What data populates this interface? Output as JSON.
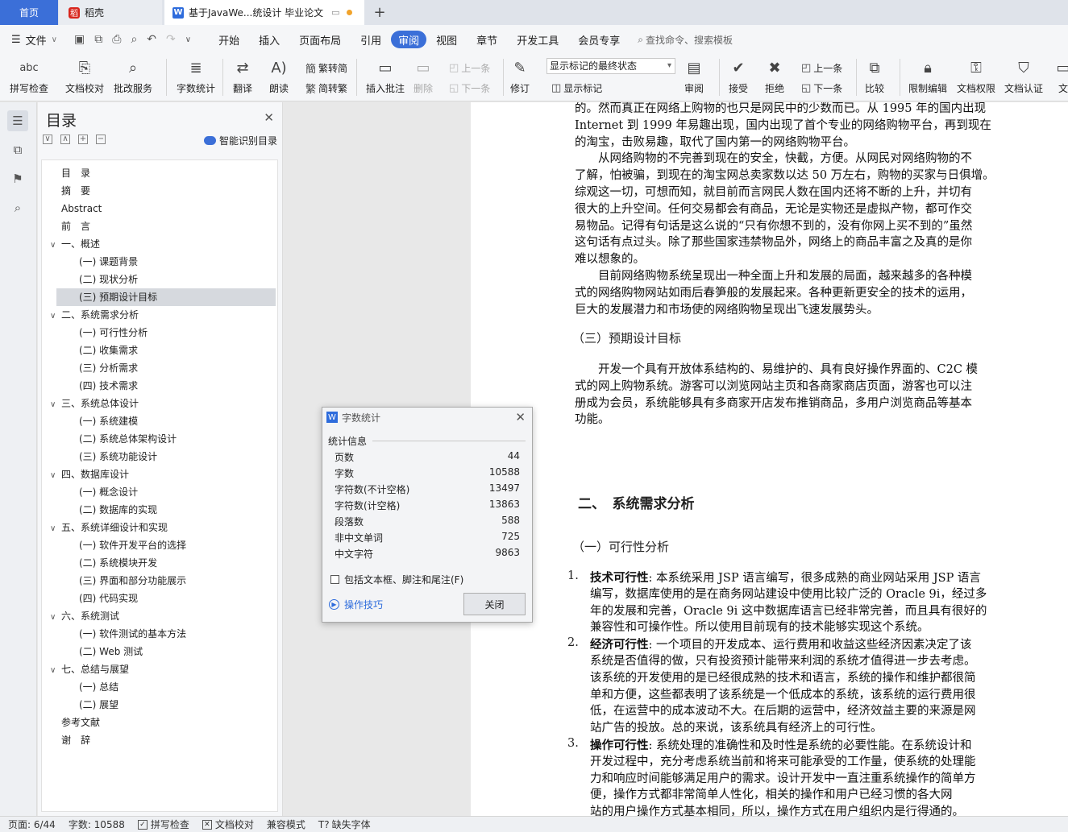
{
  "tabs": {
    "home": "首页",
    "straw": "稻壳",
    "doc": "基于JavaWe...统设计 毕业论文"
  },
  "menu": {
    "file": "文件",
    "tabs": [
      "开始",
      "插入",
      "页面布局",
      "引用",
      "审阅",
      "视图",
      "章节",
      "开发工具",
      "会员专享"
    ],
    "active_tab": "审阅",
    "search_placeholder": "查找命令、搜索模板"
  },
  "ribbon": {
    "spell": "拼写检查",
    "proofread": "文档校对",
    "correct_service": "批改服务",
    "word_count": "字数统计",
    "translate": "翻译",
    "read": "朗读",
    "trad": "繁转简",
    "simp": "简转繁",
    "insert_comment": "插入批注",
    "delete": "删除",
    "prev1": "上一条",
    "next1": "下一条",
    "revise": "修订",
    "markup_select": "显示标记的最终状态",
    "show_markup": "显示标记",
    "review": "审阅",
    "accept": "接受",
    "reject": "拒绝",
    "prev2": "上一条",
    "next2": "下一条",
    "compare": "比较",
    "restrict": "限制编辑",
    "permission": "文档权限",
    "certify": "文档认证",
    "more": "文"
  },
  "toc": {
    "title": "目录",
    "smart": "智能识别目录",
    "items": [
      {
        "text": "目　录",
        "level": 1,
        "arrow": ""
      },
      {
        "text": "摘　要",
        "level": 1,
        "arrow": ""
      },
      {
        "text": "Abstract",
        "level": 1,
        "arrow": ""
      },
      {
        "text": "前　言",
        "level": 1,
        "arrow": ""
      },
      {
        "text": "一、概述",
        "level": 0,
        "arrow": "∨"
      },
      {
        "text": "(一) 课题背景",
        "level": 2,
        "arrow": ""
      },
      {
        "text": "(二) 现状分析",
        "level": 2,
        "arrow": ""
      },
      {
        "text": "(三) 预期设计目标",
        "level": 2,
        "arrow": "",
        "selected": true
      },
      {
        "text": "二、系统需求分析",
        "level": 0,
        "arrow": "∨"
      },
      {
        "text": "(一) 可行性分析",
        "level": 2,
        "arrow": ""
      },
      {
        "text": "(二) 收集需求",
        "level": 2,
        "arrow": ""
      },
      {
        "text": "(三) 分析需求",
        "level": 2,
        "arrow": ""
      },
      {
        "text": "(四) 技术需求",
        "level": 2,
        "arrow": ""
      },
      {
        "text": "三、系统总体设计",
        "level": 0,
        "arrow": "∨"
      },
      {
        "text": "(一) 系统建模",
        "level": 2,
        "arrow": ""
      },
      {
        "text": "(二) 系统总体架构设计",
        "level": 2,
        "arrow": ""
      },
      {
        "text": "(三) 系统功能设计",
        "level": 2,
        "arrow": ""
      },
      {
        "text": "四、数据库设计",
        "level": 0,
        "arrow": "∨"
      },
      {
        "text": "(一) 概念设计",
        "level": 2,
        "arrow": ""
      },
      {
        "text": "(二) 数据库的实现",
        "level": 2,
        "arrow": ""
      },
      {
        "text": "五、系统详细设计和实现",
        "level": 0,
        "arrow": "∨"
      },
      {
        "text": "(一) 软件开发平台的选择",
        "level": 2,
        "arrow": ""
      },
      {
        "text": "(二) 系统模块开发",
        "level": 2,
        "arrow": ""
      },
      {
        "text": "(三) 界面和部分功能展示",
        "level": 2,
        "arrow": ""
      },
      {
        "text": "(四) 代码实现",
        "level": 2,
        "arrow": ""
      },
      {
        "text": "六、系统测试",
        "level": 0,
        "arrow": "∨"
      },
      {
        "text": "(一) 软件测试的基本方法",
        "level": 2,
        "arrow": ""
      },
      {
        "text": "(二) Web 测试",
        "level": 2,
        "arrow": ""
      },
      {
        "text": "七、总结与展望",
        "level": 0,
        "arrow": "∨"
      },
      {
        "text": "(一) 总结",
        "level": 2,
        "arrow": ""
      },
      {
        "text": "(二) 展望",
        "level": 2,
        "arrow": ""
      },
      {
        "text": "参考文献",
        "level": 1,
        "arrow": ""
      },
      {
        "text": "谢　辞",
        "level": 1,
        "arrow": ""
      }
    ]
  },
  "doc": {
    "lines_a": [
      "的。然而真正在网络上购物的也只是网民中的少数而已。从 1995 年的国内出现",
      "Internet 到 1999 年易趣出现，国内出现了首个专业的网络购物平台，再到现在",
      "的淘宝，击败易趣，取代了国内第一的网络购物平台。",
      "　　从网络购物的不完善到现在的安全，快截，方便。从网民对网络购物的不",
      "了解，怕被骗，到现在的淘宝网总卖家数以达 50 万左右，购物的买家与日俱增。",
      "综观这一切，可想而知，就目前而言网民人数在国内还将不断的上升，并切有",
      "很大的上升空间。任何交易都会有商品，无论是实物还是虚拟产物，都可作交",
      "易物品。记得有句话是这么说的“只有你想不到的，没有你网上买不到的”虽然",
      "这句话有点过头。除了那些国家违禁物品外，网络上的商品丰富之及真的是你",
      "难以想象的。",
      "　　目前网络购物系统呈现出一种全面上升和发展的局面，越来越多的各种模",
      "式的网络购物网站如雨后春笋般的发展起来。各种更新更安全的技术的运用，",
      "巨大的发展潜力和市场使的网络购物呈现出飞速发展势头。"
    ],
    "sub3": "（三）预期设计目标",
    "lines_b": [
      "　　开发一个具有开放体系结构的、易维护的、具有良好操作界面的、C2C 模",
      "式的网上购物系统。游客可以浏览网站主页和各商家商店页面，游客也可以注",
      "册成为会员，系统能够具有多商家开店发布推销商品，多用户浏览商品等基本",
      "功能。"
    ],
    "head2": "二、　系统需求分析",
    "sub1": "（一）可行性分析",
    "items": [
      {
        "num": "1.",
        "bold": "技术可行性",
        "lines": [
          ": 本系统采用 JSP 语言编写，很多成熟的商业网站采用 JSP 语言",
          "编写，数据库使用的是在商务网站建设中使用比较广泛的 Oracle 9i，经过多",
          "年的发展和完善，Oracle 9i 这中数据库语言已经非常完善，而且具有很好的",
          "兼容性和可操作性。所以使用目前现有的技术能够实现这个系统。"
        ]
      },
      {
        "num": "2.",
        "bold": "经济可行性",
        "lines": [
          ": 一个项目的开发成本、运行费用和收益这些经济因素决定了该",
          "系统是否值得的做，只有投资预计能带来利润的系统才值得进一步去考虑。",
          "该系统的开发使用的是已经很成熟的技术和语言，系统的操作和维护都很简",
          "单和方便，这些都表明了该系统是一个低成本的系统，该系统的运行费用很",
          "低，在运营中的成本波动不大。在后期的运营中，经济效益主要的来源是网",
          "站广告的投放。总的来说，该系统具有经济上的可行性。"
        ]
      },
      {
        "num": "3.",
        "bold": "操作可行性",
        "lines": [
          ": 系统处理的准确性和及时性是系统的必要性能。在系统设计和",
          "开发过程中，充分考虑系统当前和将来可能承受的工作量，使系统的处理能",
          "力和响应时间能够满足用户的需求。设计开发中一直注重系统操作的简单方",
          "便，操作方式都非常简单人性化，相关的操作和用户已经习惯的各大网",
          "站的用户操作方式基本相同，所以，操作方式在用户组织内是行得通的。"
        ]
      }
    ]
  },
  "dialog": {
    "title": "字数统计",
    "section": "统计信息",
    "rows": [
      {
        "label": "页数",
        "value": "44"
      },
      {
        "label": "字数",
        "value": "10588"
      },
      {
        "label": "字符数(不计空格)",
        "value": "13497"
      },
      {
        "label": "字符数(计空格)",
        "value": "13863"
      },
      {
        "label": "段落数",
        "value": "588"
      },
      {
        "label": "非中文单词",
        "value": "725"
      },
      {
        "label": "中文字符",
        "value": "9863"
      }
    ],
    "include_label": "包括文本框、脚注和尾注(F)",
    "tips": "操作技巧",
    "close": "关闭"
  },
  "status": {
    "page": "页面: 6/44",
    "words": "字数: 10588",
    "spell": "拼写检查",
    "proof": "文档校对",
    "compat": "兼容模式",
    "missing_font": "缺失字体"
  }
}
